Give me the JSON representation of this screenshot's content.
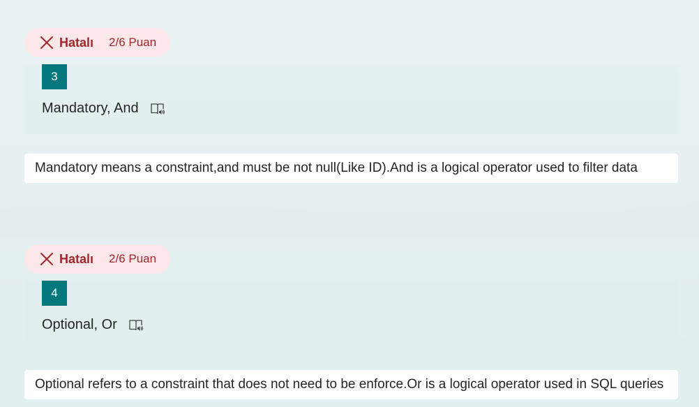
{
  "questions": [
    {
      "status_label": "Hatalı",
      "points": "2/6 Puan",
      "number": "3",
      "question_text": "Mandatory, And",
      "answer_text": "Mandatory means a constraint,and must be not null(Like ID).And is a logical operator used to filter data"
    },
    {
      "status_label": "Hatalı",
      "points": "2/6 Puan",
      "number": "4",
      "question_text": "Optional, Or",
      "answer_text": "Optional refers to a constraint that does not need to be enforce.Or is a logical operator used in SQL queries"
    }
  ],
  "icons": {
    "status": "close-icon",
    "reader": "immersive-reader-icon"
  },
  "colors": {
    "background": "#e7f1f1",
    "incorrect_badge_bg": "#fde7e9",
    "incorrect_text": "#a4262c",
    "number_badge_bg": "#03787c",
    "answer_bg": "#ffffff"
  }
}
